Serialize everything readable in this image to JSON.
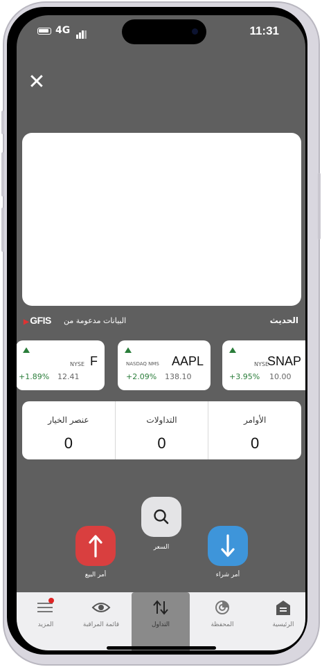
{
  "status_bar": {
    "network": "4G",
    "time": "11:31"
  },
  "header": {
    "close_icon": "close-icon"
  },
  "market": {
    "recent_label": "الحديث",
    "powered_by": "البيانات مدعومة من",
    "provider": "GFIS"
  },
  "tickers": [
    {
      "symbol": "F",
      "exchange": "NYSE",
      "change": "+1.89%",
      "price": "12.41"
    },
    {
      "symbol": "AAPL",
      "exchange": "NASDAQ NMS",
      "change": "+2.09%",
      "price": "138.10"
    },
    {
      "symbol": "SNAP",
      "exchange": "NYSE",
      "change": "+3.95%",
      "price": "10.00"
    }
  ],
  "stats": [
    {
      "label": "عنصر الخيار",
      "value": "0"
    },
    {
      "label": "التداولات",
      "value": "0"
    },
    {
      "label": "الأوامر",
      "value": "0"
    }
  ],
  "actions": {
    "sell_label": "أمر البيع",
    "quote_label": "السعر",
    "buy_label": "أمر شراء"
  },
  "tabs": [
    {
      "label": "المزيد",
      "icon": "menu-icon"
    },
    {
      "label": "قائمة المراقبة",
      "icon": "eye-icon"
    },
    {
      "label": "التداول",
      "icon": "trade-arrows-icon",
      "active": true
    },
    {
      "label": "المحفظة",
      "icon": "portfolio-icon"
    },
    {
      "label": "الرئيسية",
      "icon": "home-icon"
    }
  ],
  "colors": {
    "overlay": "#5f5f5f",
    "sell": "#d93f3f",
    "buy": "#3e95da",
    "positive": "#2a7d3a",
    "notification": "#e02424"
  }
}
